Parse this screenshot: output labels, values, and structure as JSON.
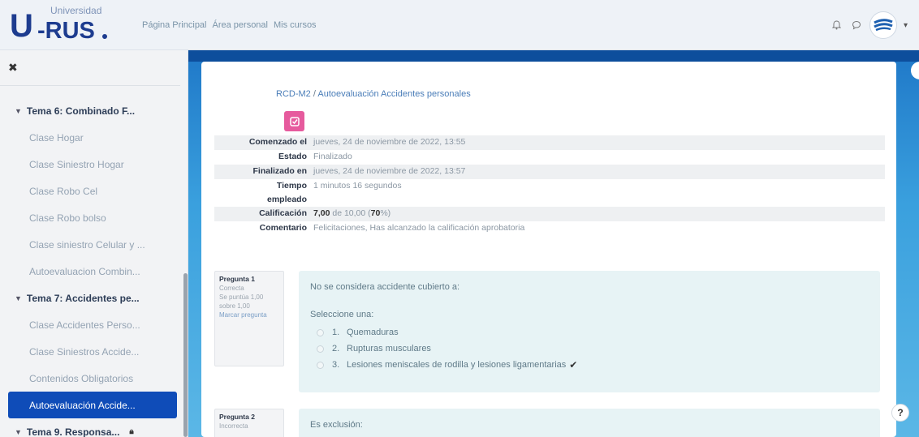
{
  "brand": {
    "small": "Universidad",
    "u": "U",
    "rus": "-RUS"
  },
  "topnav": [
    "Página Principal",
    "Área personal",
    "Mis cursos"
  ],
  "navbar_icons": {
    "bell": "bell-icon",
    "chat": "chat-bubble-icon",
    "avatar": "user-avatar",
    "caret": "▾"
  },
  "sidebar": {
    "close": "✖",
    "items": [
      {
        "type": "section",
        "label": "Tema 6: Combinado F..."
      },
      {
        "type": "link",
        "label": "Clase Hogar"
      },
      {
        "type": "link",
        "label": "Clase Siniestro Hogar"
      },
      {
        "type": "link",
        "label": "Clase Robo Cel"
      },
      {
        "type": "link",
        "label": "Clase Robo bolso"
      },
      {
        "type": "link",
        "label": "Clase siniestro Celular y ..."
      },
      {
        "type": "link",
        "label": "Autoevaluacion Combin..."
      },
      {
        "type": "section",
        "label": "Tema 7: Accidentes pe..."
      },
      {
        "type": "link",
        "label": "Clase Accidentes Perso..."
      },
      {
        "type": "link",
        "label": "Clase Siniestros Accide..."
      },
      {
        "type": "link",
        "label": "Contenidos Obligatorios"
      },
      {
        "type": "active",
        "label": "Autoevaluación Accide..."
      },
      {
        "type": "section-lock",
        "label": "Tema 9. Responsa..."
      }
    ]
  },
  "breadcrumb": {
    "course": "RCD-M2",
    "sep": "/",
    "page": "Autoevaluación Accidentes personales"
  },
  "summary": {
    "comenzado": {
      "k": "Comenzado el",
      "v": "jueves, 24 de noviembre de 2022, 13:55"
    },
    "estado": {
      "k": "Estado",
      "v": "Finalizado"
    },
    "finalizado": {
      "k": "Finalizado en",
      "v": "jueves, 24 de noviembre de 2022, 13:57"
    },
    "tiempo": {
      "k1": "Tiempo",
      "k2": "empleado",
      "v": "1 minutos 16 segundos"
    },
    "calificacion": {
      "k": "Calificación",
      "score": "7,00",
      "rest": " de 10,00 (",
      "pct": "70",
      "end": "%)"
    },
    "comentario": {
      "k": "Comentario",
      "v": "Felicitaciones, Has alcanzado la calificación aprobatoria"
    }
  },
  "questions": [
    {
      "title": "Pregunta 1",
      "status": "Correcta",
      "points": "Se puntúa 1,00 sobre 1,00",
      "flag": "Marcar pregunta",
      "prompt": "No se considera accidente cubierto a:",
      "select_label": "Seleccione una:",
      "options": [
        {
          "num": "1.",
          "text": "Quemaduras"
        },
        {
          "num": "2.",
          "text": "Rupturas musculares"
        },
        {
          "num": "3.",
          "text": "Lesiones meniscales de rodilla y lesiones ligamentarias"
        }
      ],
      "correct_mark": "✔"
    },
    {
      "title": "Pregunta 2",
      "status": "Incorrecta",
      "prompt": "Es exclusión:"
    }
  ],
  "help": "?"
}
